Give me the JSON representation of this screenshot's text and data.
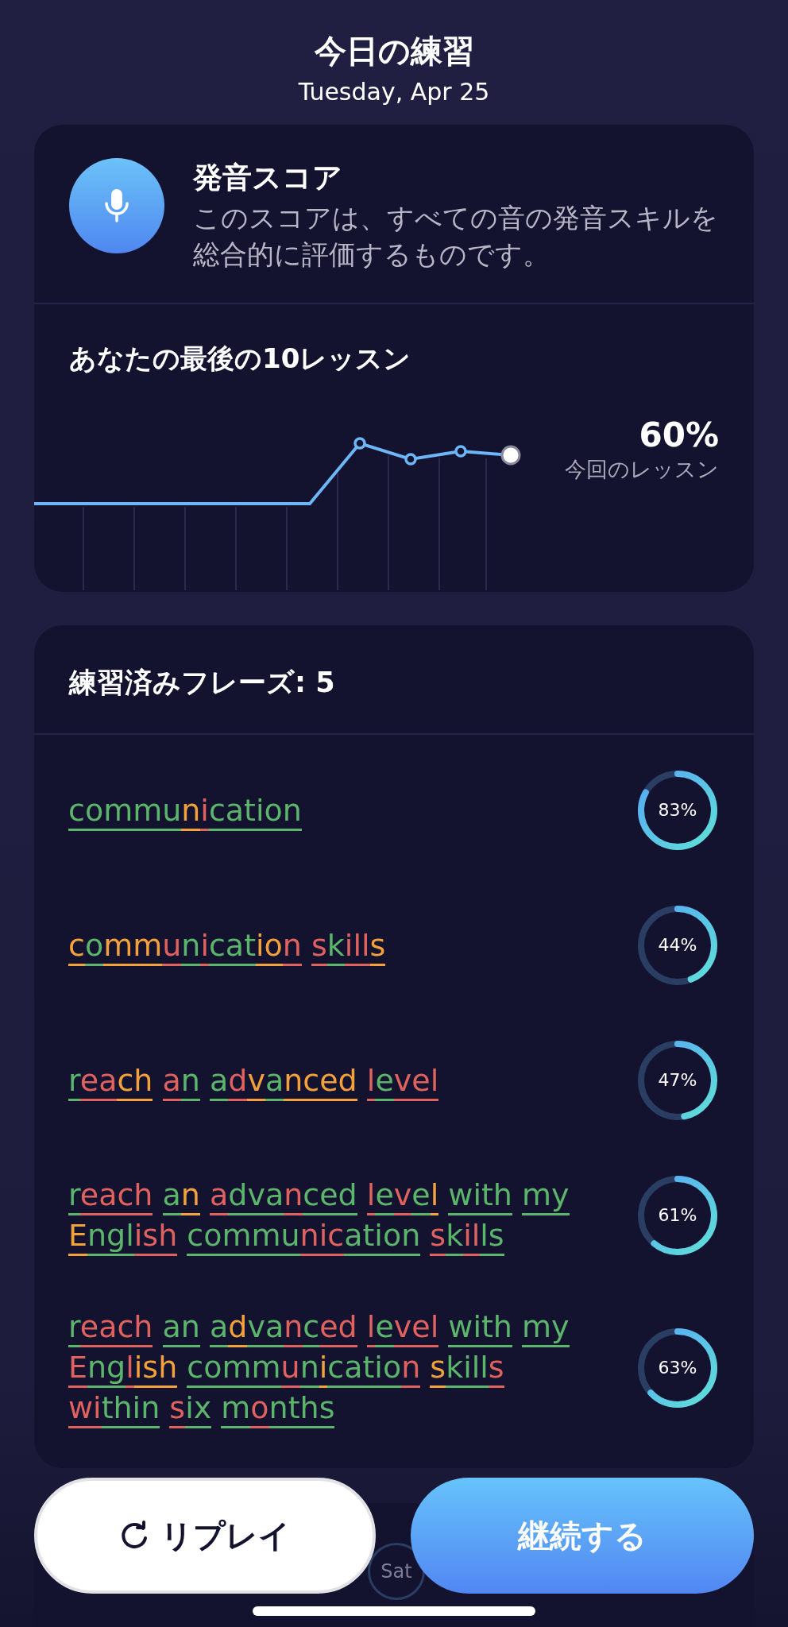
{
  "header": {
    "title": "今日の練習",
    "date": "Tuesday, Apr 25"
  },
  "score_card": {
    "title": "発音スコア",
    "description": "このスコアは、すべての音の発音スキルを総合的に評価するものです。",
    "chart_title": "あなたの最後の10レッスン",
    "current_value": "60%",
    "current_label": "今回のレッスン"
  },
  "phrases_card": {
    "title": "練習済みフレーズ: 5",
    "phrases": [
      {
        "percent": "83%",
        "level": 0.83,
        "words": [
          [
            {
              "text": "commu",
              "color": "#5bb56b"
            },
            {
              "text": "n",
              "color": "#f3a23b"
            },
            {
              "text": "i",
              "color": "#e0625f"
            },
            {
              "text": "cation",
              "color": "#5bb56b"
            }
          ]
        ]
      },
      {
        "percent": "44%",
        "level": 0.44,
        "words": [
          [
            {
              "text": "c",
              "color": "#f3a23b"
            },
            {
              "text": "o",
              "color": "#5bb56b"
            },
            {
              "text": "mm",
              "color": "#f3a23b"
            },
            {
              "text": "u",
              "color": "#e0625f"
            },
            {
              "text": "n",
              "color": "#5bb56b"
            },
            {
              "text": "i",
              "color": "#e0625f"
            },
            {
              "text": "cat",
              "color": "#5bb56b"
            },
            {
              "text": "io",
              "color": "#f3a23b"
            },
            {
              "text": "n",
              "color": "#e0625f"
            }
          ],
          [
            {
              "text": "s",
              "color": "#e0625f"
            },
            {
              "text": "k",
              "color": "#5bb56b"
            },
            {
              "text": "ill",
              "color": "#e0625f"
            },
            {
              "text": "s",
              "color": "#f3a23b"
            }
          ]
        ]
      },
      {
        "percent": "47%",
        "level": 0.47,
        "words": [
          [
            {
              "text": "r",
              "color": "#5bb56b"
            },
            {
              "text": "ea",
              "color": "#e0625f"
            },
            {
              "text": "ch",
              "color": "#f3a23b"
            }
          ],
          [
            {
              "text": "a",
              "color": "#e0625f"
            },
            {
              "text": "n",
              "color": "#5bb56b"
            }
          ],
          [
            {
              "text": "a",
              "color": "#5bb56b"
            },
            {
              "text": "d",
              "color": "#e0625f"
            },
            {
              "text": "v",
              "color": "#f3a23b"
            },
            {
              "text": "a",
              "color": "#5bb56b"
            },
            {
              "text": "nced",
              "color": "#f3a23b"
            }
          ],
          [
            {
              "text": "l",
              "color": "#e0625f"
            },
            {
              "text": "e",
              "color": "#5bb56b"
            },
            {
              "text": "vel",
              "color": "#e0625f"
            }
          ]
        ]
      },
      {
        "percent": "61%",
        "level": 0.61,
        "words": [
          [
            {
              "text": "r",
              "color": "#5bb56b"
            },
            {
              "text": "each",
              "color": "#e0625f"
            }
          ],
          [
            {
              "text": "a",
              "color": "#5bb56b"
            },
            {
              "text": "n",
              "color": "#f3a23b"
            }
          ],
          [
            {
              "text": "a",
              "color": "#e0625f"
            },
            {
              "text": "dva",
              "color": "#5bb56b"
            },
            {
              "text": "n",
              "color": "#e0625f"
            },
            {
              "text": "ced",
              "color": "#5bb56b"
            }
          ],
          [
            {
              "text": "l",
              "color": "#e0625f"
            },
            {
              "text": "e",
              "color": "#5bb56b"
            },
            {
              "text": "v",
              "color": "#e0625f"
            },
            {
              "text": "e",
              "color": "#5bb56b"
            },
            {
              "text": "l",
              "color": "#f3a23b"
            }
          ],
          [
            {
              "text": "with",
              "color": "#5bb56b"
            }
          ],
          [
            {
              "text": "my",
              "color": "#5bb56b"
            }
          ],
          [
            {
              "text": "E",
              "color": "#f3a23b"
            },
            {
              "text": "ngl",
              "color": "#5bb56b"
            },
            {
              "text": "ish",
              "color": "#e0625f"
            }
          ],
          [
            {
              "text": "commu",
              "color": "#5bb56b"
            },
            {
              "text": "nic",
              "color": "#e0625f"
            },
            {
              "text": "ation",
              "color": "#5bb56b"
            }
          ],
          [
            {
              "text": "s",
              "color": "#e0625f"
            },
            {
              "text": "k",
              "color": "#5bb56b"
            },
            {
              "text": "il",
              "color": "#e0625f"
            },
            {
              "text": "ls",
              "color": "#5bb56b"
            }
          ]
        ]
      },
      {
        "percent": "63%",
        "level": 0.63,
        "words": [
          [
            {
              "text": "r",
              "color": "#5bb56b"
            },
            {
              "text": "each",
              "color": "#e0625f"
            }
          ],
          [
            {
              "text": "an",
              "color": "#5bb56b"
            }
          ],
          [
            {
              "text": "a",
              "color": "#5bb56b"
            },
            {
              "text": "d",
              "color": "#f3a23b"
            },
            {
              "text": "va",
              "color": "#5bb56b"
            },
            {
              "text": "n",
              "color": "#e0625f"
            },
            {
              "text": "c",
              "color": "#5bb56b"
            },
            {
              "text": "ed",
              "color": "#e0625f"
            }
          ],
          [
            {
              "text": "l",
              "color": "#e0625f"
            },
            {
              "text": "e",
              "color": "#5bb56b"
            },
            {
              "text": "vel",
              "color": "#e0625f"
            }
          ],
          [
            {
              "text": "with",
              "color": "#5bb56b"
            }
          ],
          [
            {
              "text": "my",
              "color": "#5bb56b"
            }
          ],
          [
            {
              "text": "E",
              "color": "#e0625f"
            },
            {
              "text": "ng",
              "color": "#5bb56b"
            },
            {
              "text": "l",
              "color": "#e0625f"
            },
            {
              "text": "ish",
              "color": "#f3a23b"
            }
          ],
          [
            {
              "text": "comm",
              "color": "#5bb56b"
            },
            {
              "text": "u",
              "color": "#e0625f"
            },
            {
              "text": "n",
              "color": "#5bb56b"
            },
            {
              "text": "i",
              "color": "#f3a23b"
            },
            {
              "text": "catio",
              "color": "#5bb56b"
            },
            {
              "text": "n",
              "color": "#e0625f"
            }
          ],
          [
            {
              "text": "s",
              "color": "#f3a23b"
            },
            {
              "text": "kill",
              "color": "#5bb56b"
            },
            {
              "text": "s",
              "color": "#e0625f"
            }
          ],
          [
            {
              "text": "wi",
              "color": "#e0625f"
            },
            {
              "text": "thin",
              "color": "#5bb56b"
            }
          ],
          [
            {
              "text": "s",
              "color": "#e0625f"
            },
            {
              "text": "ix",
              "color": "#5bb56b"
            }
          ],
          [
            {
              "text": "m",
              "color": "#5bb56b"
            },
            {
              "text": "o",
              "color": "#e0625f"
            },
            {
              "text": "nths",
              "color": "#5bb56b"
            }
          ]
        ]
      }
    ]
  },
  "week_card": {
    "day": "Sat"
  },
  "buttons": {
    "replay": "リプレイ",
    "continue": "継続する"
  }
}
